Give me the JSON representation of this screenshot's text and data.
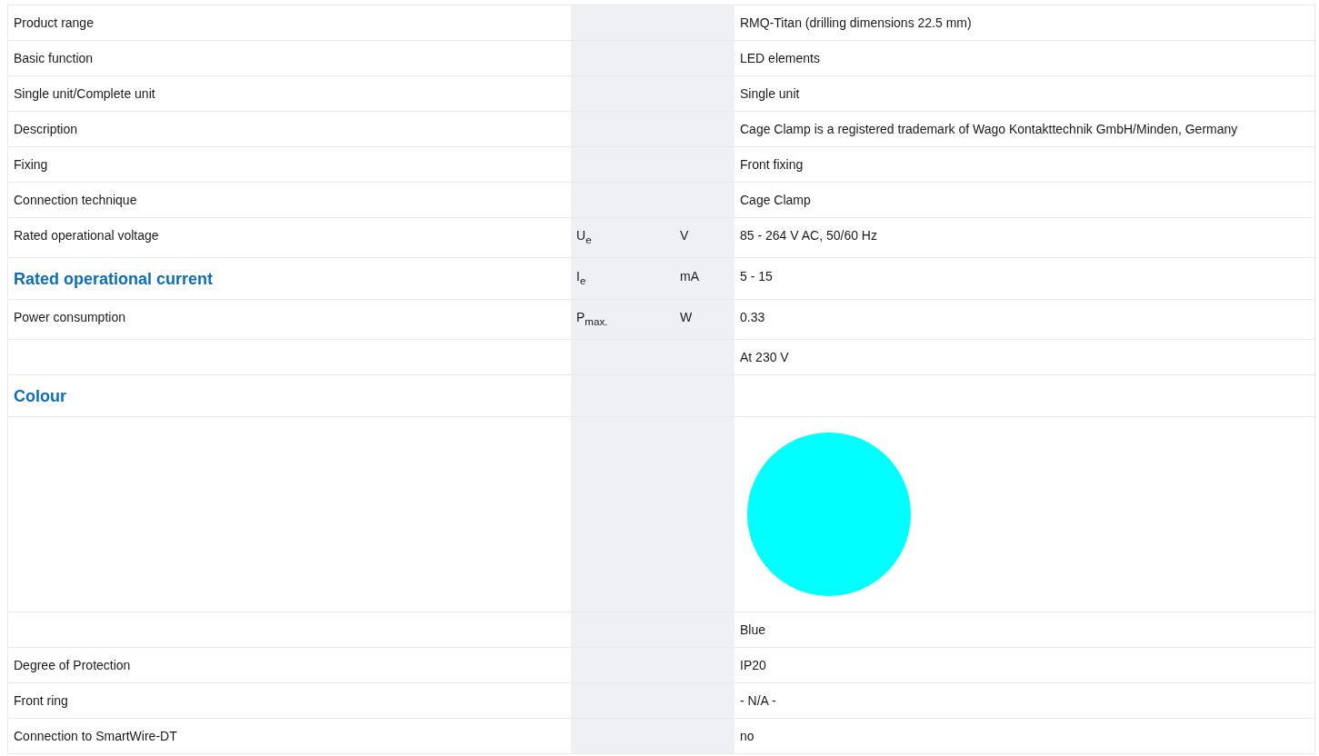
{
  "rows": [
    {
      "kind": "spec",
      "label": "Product range",
      "value": "RMQ-Titan (drilling dimensions 22.5 mm)"
    },
    {
      "kind": "spec",
      "label": "Basic function",
      "value": "LED elements"
    },
    {
      "kind": "spec",
      "label": "Single unit/Complete unit",
      "value": "Single unit"
    },
    {
      "kind": "spec",
      "label": "Description",
      "value": "Cage Clamp is a registered trademark of Wago Kontakttechnik GmbH/Minden, Germany"
    },
    {
      "kind": "spec",
      "label": "Fixing",
      "value": "Front fixing"
    },
    {
      "kind": "spec",
      "label": "Connection technique",
      "value": "Cage Clamp"
    },
    {
      "kind": "spec",
      "label": "Rated operational voltage",
      "symbol": "U$_{e}$",
      "unit": "V",
      "value": "85 - 264 V AC, 50/60 Hz"
    },
    {
      "kind": "heading",
      "label": "Rated operational current",
      "symbol": "I$_{e}$",
      "unit": "mA",
      "value": "5 - 15"
    },
    {
      "kind": "spec",
      "label": "Power consumption",
      "symbol": "P$_{max.}$",
      "unit": "W",
      "value": "0.33"
    },
    {
      "kind": "spec",
      "value": "At 230 V"
    },
    {
      "kind": "heading",
      "label": "Colour"
    },
    {
      "kind": "swatch",
      "color": "#00ffff"
    },
    {
      "kind": "spec",
      "value": "Blue"
    },
    {
      "kind": "spec",
      "label": "Degree of Protection",
      "value": "IP20"
    },
    {
      "kind": "spec",
      "label": "Front ring",
      "value": "- N/A -"
    },
    {
      "kind": "spec",
      "label": "Connection to SmartWire-DT",
      "value": "no"
    }
  ]
}
